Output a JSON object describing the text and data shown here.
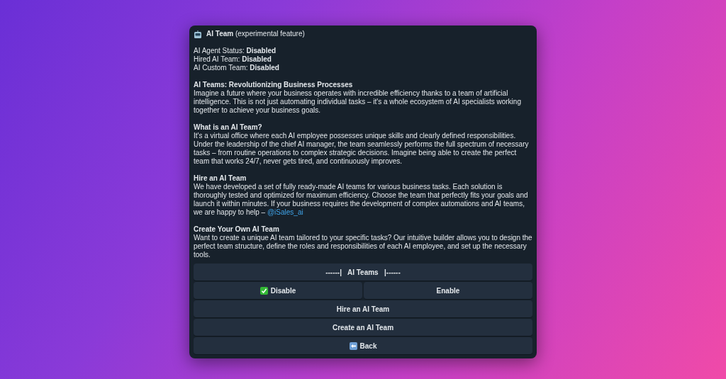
{
  "window": {
    "title": "AI Team",
    "subtitle": "(experimental feature)"
  },
  "status": [
    {
      "label": "AI Agent Status:",
      "value": "Disabled"
    },
    {
      "label": "Hired AI Team:",
      "value": "Disabled"
    },
    {
      "label": "AI Custom Team:",
      "value": "Disabled"
    }
  ],
  "sections": [
    {
      "heading": "AI Teams: Revolutionizing Business Processes",
      "text": "Imagine a future where your business operates with incredible efficiency thanks to a team of artificial intelligence. This is not just automating individual tasks – it's a whole ecosystem of AI specialists working together to achieve your business goals."
    },
    {
      "heading": "What is an AI Team?",
      "text": "It's a virtual office where each AI employee possesses unique skills and clearly defined responsibilities. Under the leadership of the chief AI manager, the team seamlessly performs the full spectrum of necessary tasks – from routine operations to complex strategic decisions. Imagine being able to create the perfect team that works 24/7, never gets tired, and continuously improves."
    },
    {
      "heading": "Hire an AI Team",
      "text": "We have developed a set of fully ready-made AI teams for various business tasks. Each solution is thoroughly tested and optimized for maximum efficiency. Choose the team that perfectly fits your goals and launch it within minutes. If your business requires the development of complex automations and AI teams, we are happy to help – ",
      "link": "@iSales_ai"
    },
    {
      "heading": "Create Your Own AI Team",
      "text": "Want to create a unique AI team tailored to your specific tasks? Our intuitive builder allows you to design the perfect team structure, define the roles and responsibilities of each AI employee, and set up the necessary tools."
    }
  ],
  "button_rows": [
    [
      {
        "label": "------|   AI Teams   |------",
        "kind": "plain"
      }
    ],
    [
      {
        "label": "Disable",
        "kind": "option",
        "selected": true
      },
      {
        "label": "Enable",
        "kind": "option",
        "selected": false
      }
    ],
    [
      {
        "label": "Hire an AI Team",
        "kind": "plain"
      }
    ],
    [
      {
        "label": "Create an AI Team",
        "kind": "plain"
      }
    ],
    [
      {
        "label": "Back",
        "kind": "back"
      }
    ]
  ]
}
